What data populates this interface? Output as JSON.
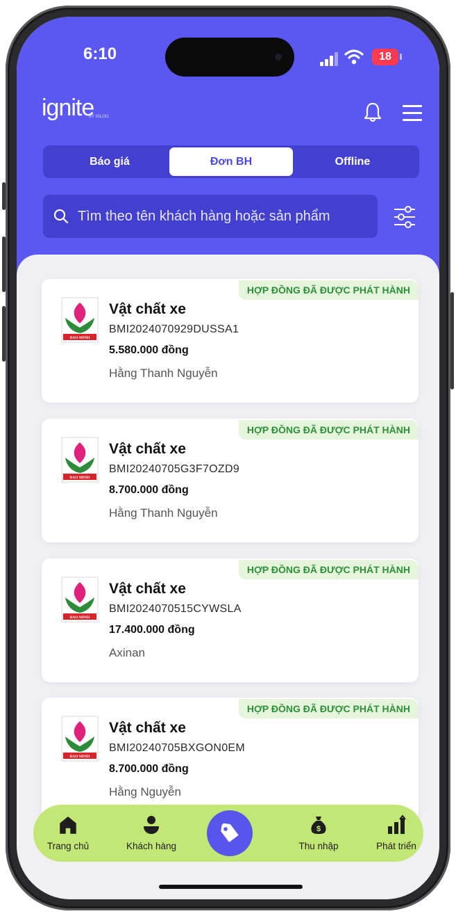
{
  "status_bar": {
    "time": "6:10",
    "battery": "18"
  },
  "header": {
    "logo": "ignite",
    "logo_sub": "BY IGLOO"
  },
  "tabs": [
    {
      "label": "Báo giá",
      "active": false
    },
    {
      "label": "Đơn BH",
      "active": true
    },
    {
      "label": "Offline",
      "active": false
    }
  ],
  "search": {
    "placeholder": "Tìm theo tên khách hàng hoặc sản phẩm"
  },
  "policies": [
    {
      "status": "HỢP ĐỒNG ĐÃ ĐƯỢC PHÁT HÀNH",
      "product": "Vật chất xe",
      "contract_no": "BMI2024070929DUSSA1",
      "premium": "5.580.000 đồng",
      "customer": "Hằng Thanh Nguyễn",
      "insurer": "BAO MINH"
    },
    {
      "status": "HỢP ĐỒNG ĐÃ ĐƯỢC PHÁT HÀNH",
      "product": "Vật chất xe",
      "contract_no": "BMI20240705G3F7OZD9",
      "premium": "8.700.000 đồng",
      "customer": "Hằng Thanh Nguyễn",
      "insurer": "BAO MINH"
    },
    {
      "status": "HỢP ĐỒNG ĐÃ ĐƯỢC PHÁT HÀNH",
      "product": "Vật chất xe",
      "contract_no": "BMI2024070515CYWSLA",
      "premium": "17.400.000 đồng",
      "customer": "Axinan",
      "insurer": "BAO MINH"
    },
    {
      "status": "HỢP ĐỒNG ĐÃ ĐƯỢC PHÁT HÀNH",
      "product": "Vật chất xe",
      "contract_no": "BMI20240705BXGON0EM",
      "premium": "8.700.000 đồng",
      "customer": "Hằng Nguyễn",
      "insurer": "BAO MINH"
    }
  ],
  "bottom_nav": [
    {
      "label": "Trang chủ",
      "icon": "home-icon"
    },
    {
      "label": "Khách hàng",
      "icon": "customer-icon"
    },
    {
      "label": "",
      "icon": "tag-icon"
    },
    {
      "label": "Thu nhập",
      "icon": "money-bag-icon"
    },
    {
      "label": "Phát triển",
      "icon": "growth-chart-icon"
    }
  ],
  "colors": {
    "primary": "#5a57f2",
    "nav_bg": "#c3e774",
    "status_green": "#2f8f3b",
    "status_bg": "#e4f5dc"
  }
}
